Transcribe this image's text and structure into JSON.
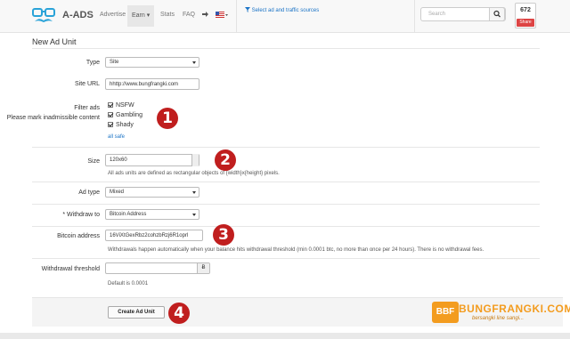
{
  "navbar": {
    "brand": "A-ADS",
    "items": {
      "advertise": "Advertise",
      "earn": "Earn ▾",
      "stats": "Stats",
      "faq": "FAQ"
    },
    "sources_link": "Select ad and traffic sources",
    "search_placeholder": "Search",
    "share_count": "672",
    "share_label": "Share"
  },
  "page": {
    "title": "New Ad Unit",
    "fields": {
      "type": {
        "label": "Type",
        "value": "Site"
      },
      "site_url": {
        "label": "Site URL",
        "value": "hhttp://www.bungfrangki.com"
      },
      "filter": {
        "label": "Filter ads",
        "note": "Please mark inadmissible content",
        "options": [
          "NSFW",
          "Gambling",
          "Shady"
        ],
        "all_safe": "all safe"
      },
      "size": {
        "label": "Size",
        "value": "120x60",
        "help": "All ads units are defined as rectangular objects of {width}x{height} pixels."
      },
      "ad_type": {
        "label": "Ad type",
        "value": "Mixed"
      },
      "withdraw_to": {
        "label": "* Withdraw to",
        "value": "Bitcoin Address"
      },
      "bitcoin_address": {
        "label": "Bitcoin address",
        "value": "16ViXtGexRbz2cohzbRzj6R1oprl",
        "help": "Withdrawals happen automatically when your balance hits withdrawal threshold (min 0.0001 btc, no more than once per 24 hours). There is no withdrawal fees."
      },
      "threshold": {
        "label": "Withdrawal threshold",
        "currency": "Ƀ",
        "help": "Default is 0.0001"
      }
    },
    "submit": "Create Ad Unit",
    "badges": [
      "1",
      "2",
      "3",
      "4"
    ]
  },
  "watermark": {
    "logo": "BBF",
    "text": "BUNGFRANGKI.COM",
    "sub": "bersangki line sangi..."
  },
  "colors": {
    "accent": "#1a73c6",
    "badge": "#c01e1e",
    "share": "#dd4444",
    "watermark": "#f39c1f"
  }
}
